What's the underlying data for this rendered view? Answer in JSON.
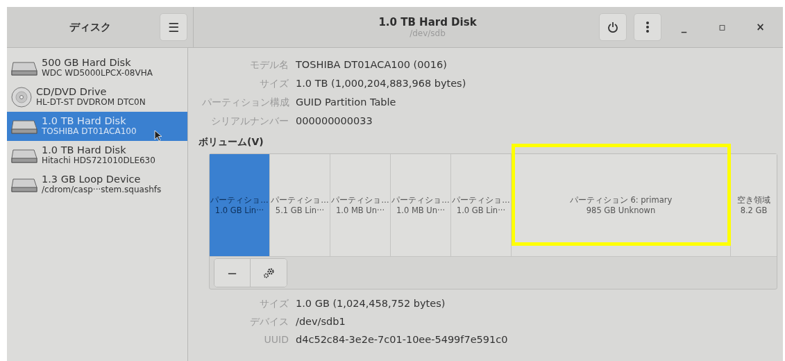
{
  "sidebar": {
    "title": "ディスク",
    "menu_button": "☰",
    "items": [
      {
        "kind": "disk",
        "name": "500 GB Hard Disk",
        "model": "WDC WD5000LPCX-08VHA",
        "selected": false
      },
      {
        "kind": "optical",
        "name": "CD/DVD Drive",
        "model": "HL-DT-ST DVDROM DTC0N",
        "selected": false
      },
      {
        "kind": "disk",
        "name": "1.0 TB Hard Disk",
        "model": "TOSHIBA DT01ACA100",
        "selected": true
      },
      {
        "kind": "disk",
        "name": "1.0 TB Hard Disk",
        "model": "Hitachi HDS721010DLE630",
        "selected": false
      },
      {
        "kind": "disk",
        "name": "1.3 GB Loop Device",
        "model": "/cdrom/casp···stem.squashfs",
        "selected": false
      }
    ]
  },
  "header": {
    "title": "1.0 TB Hard Disk",
    "subtitle": "/dev/sdb",
    "window_controls": [
      "_",
      "▫",
      "×"
    ]
  },
  "drive_details": [
    {
      "label": "モデル名",
      "value": "TOSHIBA DT01ACA100 (0016)"
    },
    {
      "label": "サイズ",
      "value": "1.0 TB (1,000,204,883,968 bytes)"
    },
    {
      "label": "パーティション構成",
      "value": "GUID Partition Table"
    },
    {
      "label": "シリアルナンバー",
      "value": "000000000033"
    }
  ],
  "volumes": {
    "heading": "ボリューム(V)",
    "partitions": [
      {
        "kind": "narrow",
        "name": "パーティショ…",
        "info": "1.0 GB Lin···",
        "selected": true,
        "highlighted": false
      },
      {
        "kind": "narrow",
        "name": "パーティショ…",
        "info": "5.1 GB Lin···",
        "selected": false,
        "highlighted": false
      },
      {
        "kind": "narrow",
        "name": "パーティショ…",
        "info": "1.0 MB Un···",
        "selected": false,
        "highlighted": false
      },
      {
        "kind": "narrow",
        "name": "パーティショ…",
        "info": "1.0 MB Un···",
        "selected": false,
        "highlighted": false
      },
      {
        "kind": "narrow",
        "name": "パーティショ…",
        "info": "1.0 GB Lin···",
        "selected": false,
        "highlighted": false
      },
      {
        "kind": "wide",
        "name": "パーティション 6: primary",
        "info": "985 GB Unknown",
        "selected": false,
        "highlighted": true
      },
      {
        "kind": "free",
        "name": "空き領域",
        "info": "8.2 GB",
        "selected": false,
        "highlighted": false
      }
    ],
    "toolbar": [
      "−"
    ]
  },
  "volume_details": [
    {
      "label": "サイズ",
      "value": "1.0 GB (1,024,458,752 bytes)"
    },
    {
      "label": "デバイス",
      "value": "/dev/sdb1"
    },
    {
      "label": "UUID",
      "value": "d4c52c84-3e2e-7c01-10ee-5499f7e591c0"
    }
  ]
}
